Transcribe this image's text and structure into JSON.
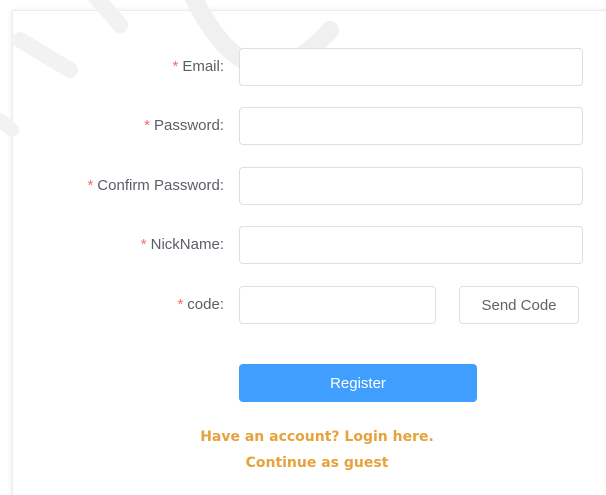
{
  "form": {
    "required_mark": "*",
    "fields": [
      {
        "label": "Email:",
        "value": ""
      },
      {
        "label": "Password:",
        "value": ""
      },
      {
        "label": "Confirm Password:",
        "value": ""
      },
      {
        "label": "NickName:",
        "value": ""
      },
      {
        "label": "code:",
        "value": ""
      }
    ],
    "send_code_label": "Send Code",
    "register_label": "Register"
  },
  "links": {
    "login": "Have an account? Login here.",
    "guest": "Continue as guest"
  },
  "colors": {
    "primary": "#409eff",
    "required": "#f56c6c",
    "link": "#e6a23c",
    "label": "#5a5e66",
    "border": "#dcdfe6"
  }
}
